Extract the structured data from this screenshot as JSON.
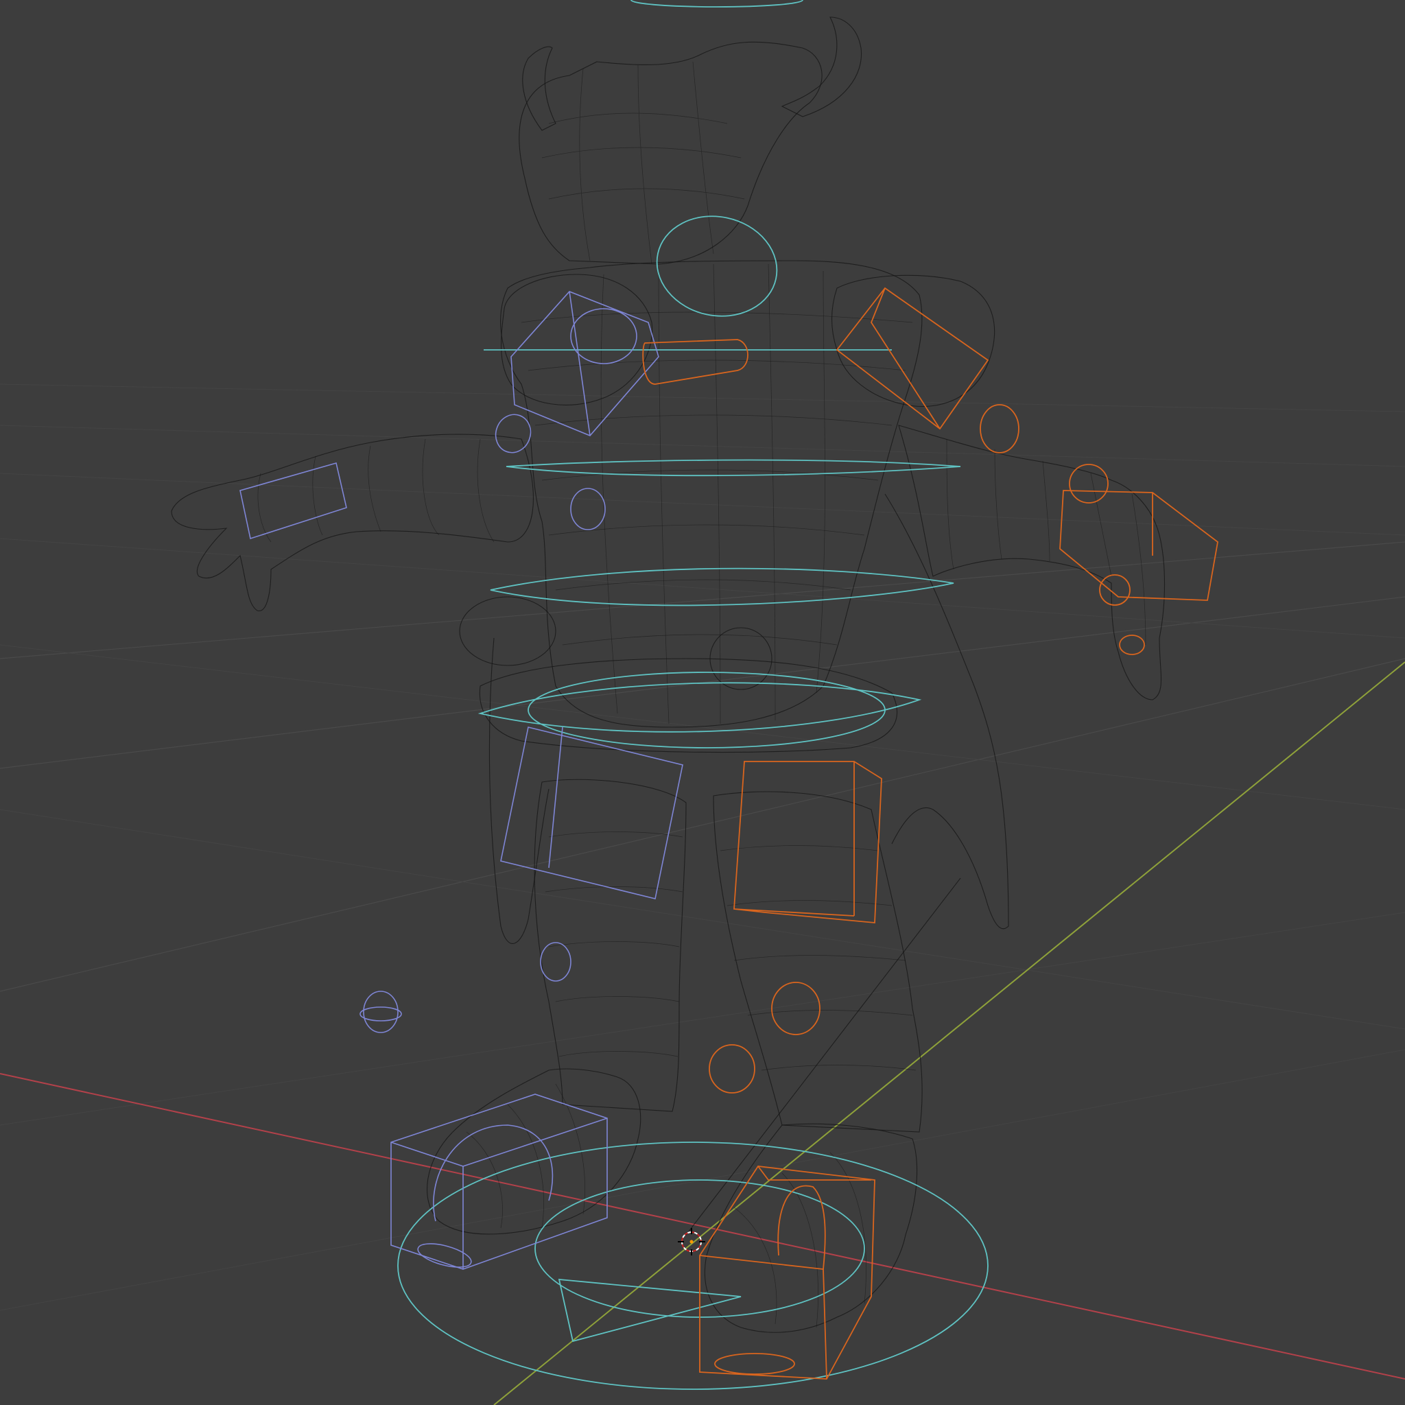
{
  "viewport": {
    "mode": "wireframe",
    "background_color": "#3d3d3d",
    "grid_color": "#4a4a4a",
    "axis_x_color": "#b3414a",
    "axis_y_color": "#8fa23a"
  },
  "scene": {
    "mesh_color": "#141414",
    "controls": {
      "center_color": "#5fc3c3",
      "left_color": "#7f86d6",
      "right_color": "#d9651e"
    },
    "origin_marker": "3d-cursor-icon"
  }
}
